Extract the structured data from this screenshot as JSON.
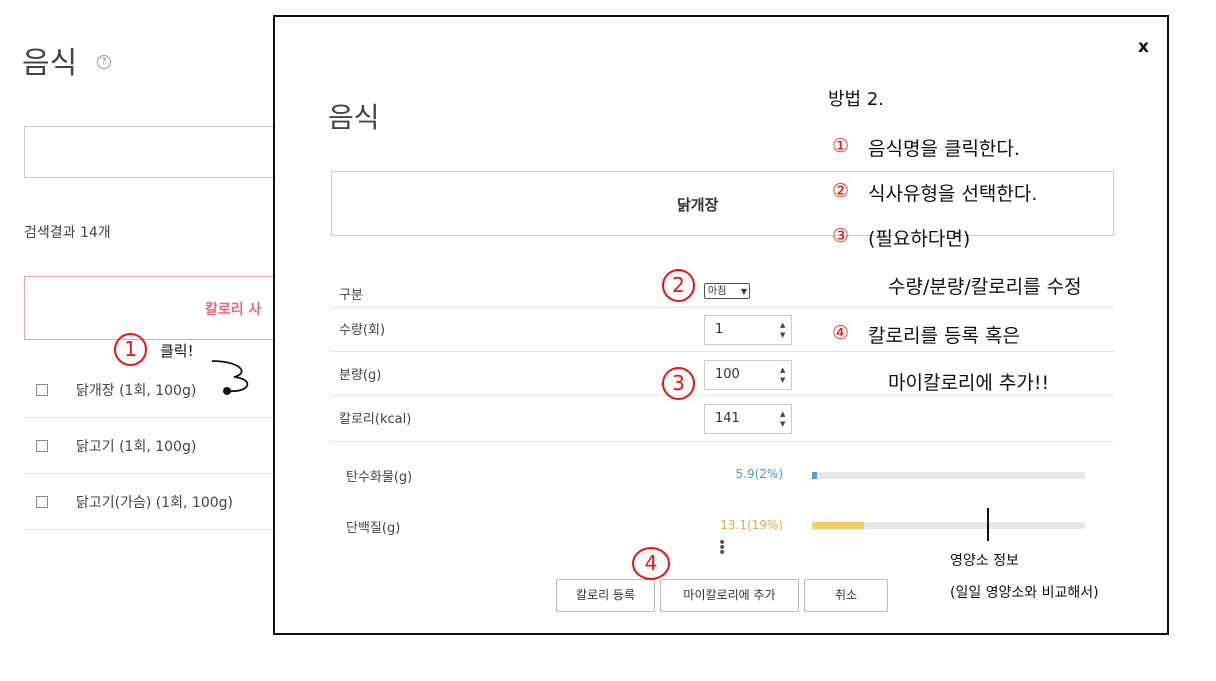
{
  "background": {
    "title": "음식",
    "help_icon": "?",
    "result_count": "검색결과 14개",
    "calorie_button": "칼로리 사",
    "items": [
      {
        "label": "닭개장  (1회, 100g)"
      },
      {
        "label": "닭고기  (1회, 100g)"
      },
      {
        "label": "닭고기(가슴)  (1회, 100g)"
      }
    ]
  },
  "modal": {
    "close": "x",
    "title": "음식",
    "food_name": "닭개장",
    "fields": {
      "category_label": "구분",
      "category_value": "아침",
      "amount_label": "수량(회)",
      "amount_value": "1",
      "weight_label": "분량(g)",
      "weight_value": "100",
      "calorie_label": "칼로리(kcal)",
      "calorie_value": "141"
    },
    "nutrients": [
      {
        "label": "탄수화물(g)",
        "value": "5.9(2%)",
        "percent": 2,
        "color": "#5aa0c8"
      },
      {
        "label": "단백질(g)",
        "value": "13.1(19%)",
        "percent": 19,
        "color": "#f6c96a"
      }
    ],
    "buttons": {
      "register": "칼로리 등록",
      "add_my": "마이칼로리에 추가",
      "cancel": "취소"
    }
  },
  "annotations": {
    "method_title": "방법 2.",
    "step1": "음식명을 클릭한다.",
    "step2": "식사유형을 선택한다.",
    "step3": "(필요하다면)",
    "step3b": "수량/분량/칼로리를 수정",
    "step4": "칼로리를 등록 혹은",
    "step4b": "마이칼로리에 추가!!",
    "click_note": "클릭!",
    "nutrition_note": "영양소 정보",
    "nutrition_note2": "(일일 영양소와 비교해서)",
    "num1": "①",
    "num2": "②",
    "num3": "③",
    "num4": "④",
    "red1": "1",
    "red2": "2",
    "red3": "3",
    "red4": "4"
  }
}
